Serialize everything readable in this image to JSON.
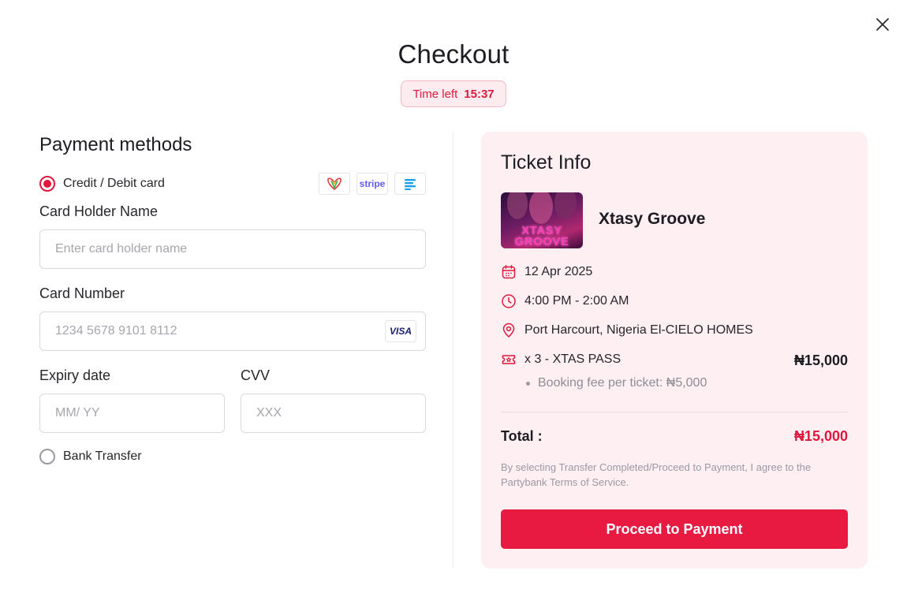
{
  "header": {
    "title": "Checkout",
    "timer_label": "Time left",
    "timer_value": "15:37"
  },
  "payment": {
    "section_title": "Payment methods",
    "methods": [
      {
        "label": "Credit / Debit card",
        "selected": true
      },
      {
        "label": "Bank Transfer",
        "selected": false
      }
    ],
    "logos": [
      "paystack-logo",
      "stripe-logo",
      "flutterwave-logo"
    ],
    "stripe_text": "stripe",
    "card_holder": {
      "label": "Card Holder Name",
      "placeholder": "Enter card holder name",
      "value": ""
    },
    "card_number": {
      "label": "Card Number",
      "placeholder": "1234 5678 9101 8112",
      "value": "",
      "brand": "VISA"
    },
    "expiry": {
      "label": "Expiry date",
      "placeholder": "MM/ YY",
      "value": ""
    },
    "cvv": {
      "label": "CVV",
      "placeholder": "XXX",
      "value": ""
    }
  },
  "ticket": {
    "title": "Ticket Info",
    "event_name": "Xtasy Groove",
    "image_text_line1": "XTASY",
    "image_text_line2": "GROOVE",
    "date": "12 Apr 2025",
    "time": "4:00 PM - 2:00 AM",
    "location": "Port Harcourt, Nigeria El-CIELO HOMES",
    "ticket_line": "x 3 - XTAS PASS",
    "ticket_price": "₦15,000",
    "booking_fee": "Booking fee per ticket: ₦5,000",
    "total_label": "Total :",
    "total_value": "₦15,000",
    "terms": "By selecting Transfer Completed/Proceed to Payment, I agree to the Partybank Terms of Service.",
    "proceed_label": "Proceed to Payment"
  },
  "colors": {
    "accent": "#e81a42",
    "card_bg": "#fdeff2",
    "timer_bg": "#fdecef"
  }
}
